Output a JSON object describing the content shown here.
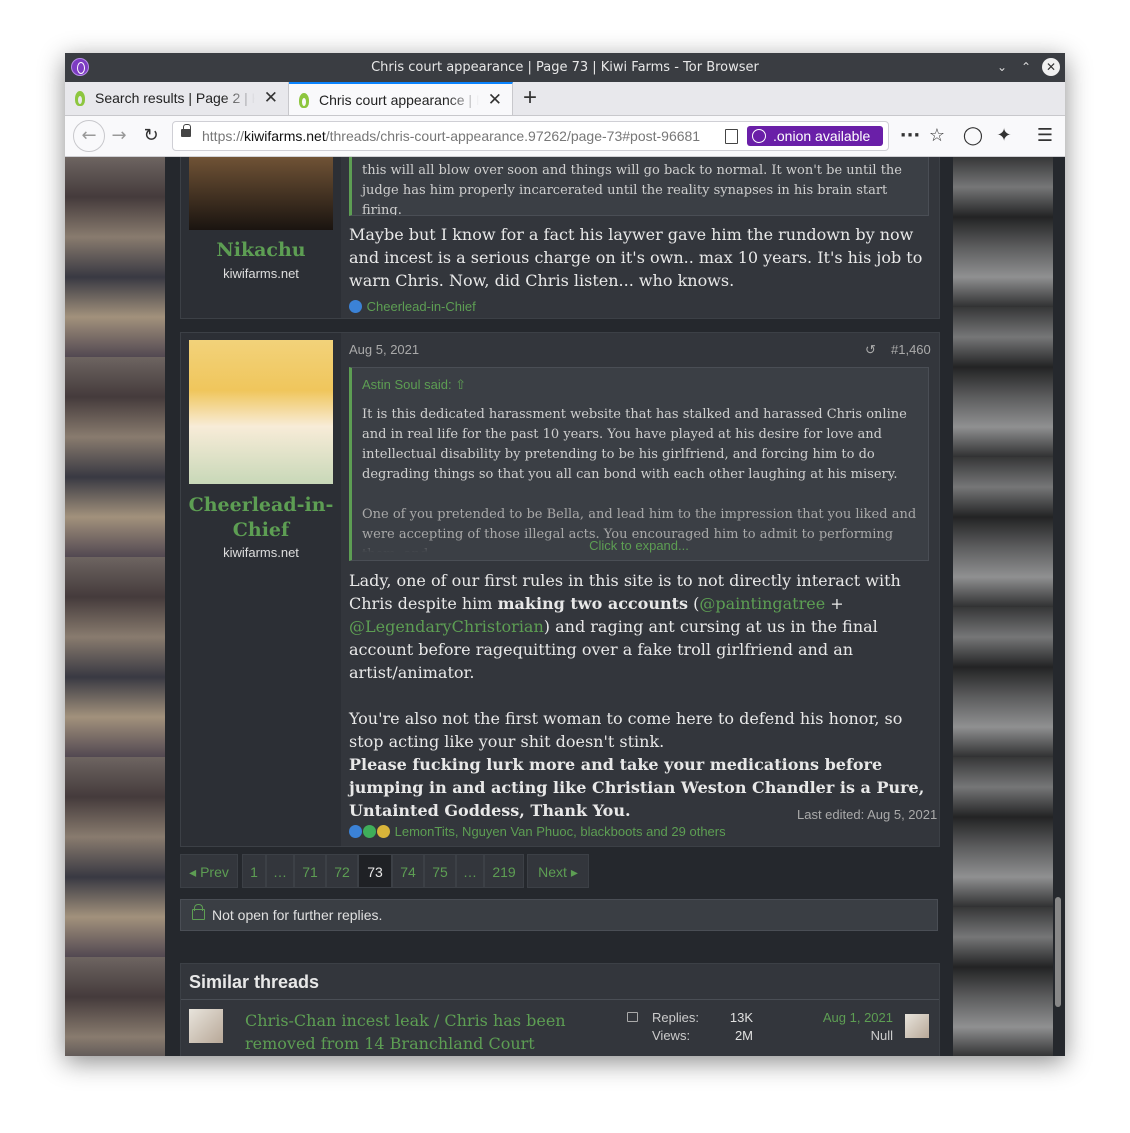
{
  "window": {
    "title": "Chris court appearance | Page 73 | Kiwi Farms - Tor Browser"
  },
  "tabs": [
    {
      "label": "Search results | Page 2 | Kiwi Farms"
    },
    {
      "label": "Chris court appearance | Page 73 | Kiwi Farms"
    }
  ],
  "navbar": {
    "url_prefix": "https://",
    "url_domain": "kiwifarms.net",
    "url_path": "/threads/chris-court-appearance.97262/page-73#post-96681",
    "onion_label": ".onion available"
  },
  "post1": {
    "username": "Nikachu",
    "site": "kiwifarms.net",
    "quote_text": "Chris's charges still haven't been finalized yet, he probably honestly still believes this will all blow over soon and things will go back to normal. It won't be until the judge has him properly incarcerated until the reality synapses in his brain start firing.",
    "message": "Maybe but I know for a fact his laywer gave him the rundown by now and incest is a serious charge on it's own.. max 10 years. It's his job to warn Chris. Now, did Chris listen... who knows.",
    "reactions": "Cheerlead-in-Chief"
  },
  "post2": {
    "username": "Cheerlead-in-Chief",
    "site": "kiwifarms.net",
    "date": "Aug 5, 2021",
    "post_number": "#1,460",
    "quote_author": "Astin Soul said:",
    "quote_p1": "It is this dedicated harassment website that has stalked and harassed Chris online and in real life for the past 10 years. You have played at his desire for love and intellectual disability by pretending to be his girlfriend, and forcing him to do degrading things so that you all can bond with each other laughing at his misery.",
    "quote_p2": "One of you pretended to be Bella, and lead him to the impression that you liked and were accepting of those illegal acts. You encouraged him to admit to performing them, and",
    "click_expand": "Click to expand...",
    "msg_a": "Lady, one of our first rules in this site is to not directly interact with Chris despite him ",
    "msg_bold": "making two accounts",
    "msg_b": " (",
    "mention1": "@paintingatree",
    "msg_c": " + ",
    "mention2": "@LegendaryChristorian",
    "msg_d": ") and raging ant cursing at us in the final account before ragequitting over a fake troll girlfriend and an artist/animator.",
    "msg_p2": "You're also not the first woman to come here to defend his honor, so stop acting like your shit doesn't stink.",
    "msg_p3": "Please fucking lurk more and take your medications before jumping in and acting like Christian Weston Chandler is a Pure, Untainted Goddess, Thank You.",
    "last_edited": "Last edited: Aug 5, 2021",
    "reactions": "LemonTits, Nguyen Van Phuoc, blackboots and 29 others"
  },
  "pagination": {
    "prev": "Prev",
    "next": "Next",
    "pages": [
      "1",
      "…",
      "71",
      "72",
      "73",
      "74",
      "75",
      "…",
      "219"
    ],
    "current": "73"
  },
  "closed_notice": "Not open for further replies.",
  "similar_threads": {
    "heading": "Similar threads",
    "items": [
      {
        "title_line1": "Chris-Chan incest leak / Chris has been",
        "title_line2": "removed from 14 Branchland Court",
        "replies_label": "Replies:",
        "replies": "13K",
        "views_label": "Views:",
        "views": "2M",
        "date": "Aug 1, 2021",
        "last_poster": "Null"
      }
    ]
  },
  "colors": {
    "accent": "#5d9e53",
    "background": "#25282d",
    "panel": "#33363c",
    "onion": "#6a1fa8"
  }
}
